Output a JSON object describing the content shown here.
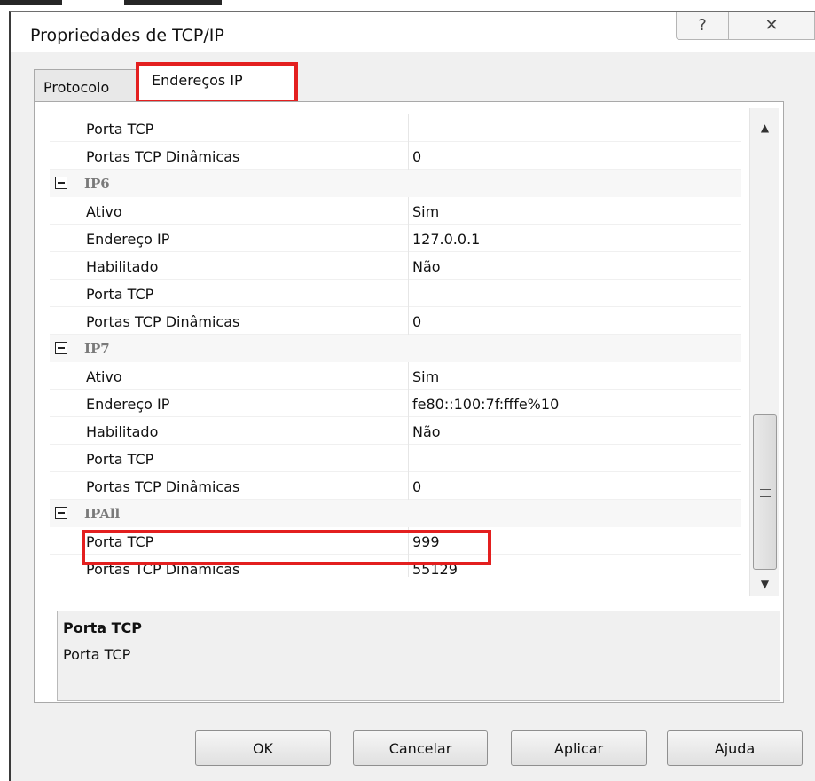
{
  "window": {
    "title": "Propriedades de TCP/IP",
    "help_glyph": "?",
    "close_glyph": "✕"
  },
  "tabs": [
    {
      "label": "Protocolo",
      "selected": false
    },
    {
      "label": "Endereços IP",
      "selected": true
    }
  ],
  "grid": {
    "rows": [
      {
        "kind": "item",
        "label": "Porta TCP",
        "value": ""
      },
      {
        "kind": "item",
        "label": "Portas TCP Dinâmicas",
        "value": "0"
      },
      {
        "kind": "group",
        "label": "IP6"
      },
      {
        "kind": "item",
        "label": "Ativo",
        "value": "Sim"
      },
      {
        "kind": "item",
        "label": "Endereço IP",
        "value": "127.0.0.1"
      },
      {
        "kind": "item",
        "label": "Habilitado",
        "value": "Não"
      },
      {
        "kind": "item",
        "label": "Porta TCP",
        "value": ""
      },
      {
        "kind": "item",
        "label": "Portas TCP Dinâmicas",
        "value": "0"
      },
      {
        "kind": "group",
        "label": "IP7"
      },
      {
        "kind": "item",
        "label": "Ativo",
        "value": "Sim"
      },
      {
        "kind": "item",
        "label": "Endereço IP",
        "value": "fe80::100:7f:fffe%10"
      },
      {
        "kind": "item",
        "label": "Habilitado",
        "value": "Não"
      },
      {
        "kind": "item",
        "label": "Porta TCP",
        "value": ""
      },
      {
        "kind": "item",
        "label": "Portas TCP Dinâmicas",
        "value": "0"
      },
      {
        "kind": "group",
        "label": "IPAll"
      },
      {
        "kind": "item",
        "label": "Porta TCP",
        "value": "999"
      },
      {
        "kind": "item",
        "label": "Portas TCP Dinâmicas",
        "value": "55129"
      }
    ],
    "scroll": {
      "up_glyph": "▲",
      "down_glyph": "▼"
    }
  },
  "description": {
    "title": "Porta TCP",
    "text": "Porta TCP"
  },
  "buttons": {
    "ok": "OK",
    "cancel": "Cancelar",
    "apply": "Aplicar",
    "help": "Ajuda"
  },
  "highlight_color": "#e31f1f"
}
